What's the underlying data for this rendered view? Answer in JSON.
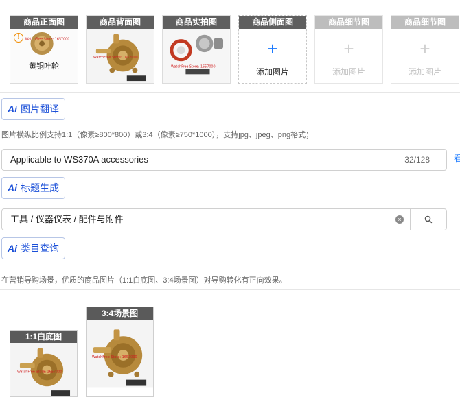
{
  "image_slots": [
    {
      "label": "商品正面图",
      "state": "filled",
      "caption": "黄铜叶轮",
      "warning_symbol": "!"
    },
    {
      "label": "商品背面图",
      "state": "filled",
      "caption": ""
    },
    {
      "label": "商品实拍图",
      "state": "filled",
      "caption": ""
    },
    {
      "label": "商品侧面图",
      "state": "empty",
      "add_symbol": "+",
      "add_text": "添加图片"
    },
    {
      "label": "商品细节图",
      "state": "disabled",
      "add_symbol": "+",
      "add_text": "添加图片"
    },
    {
      "label": "商品细节图",
      "state": "disabled",
      "add_symbol": "+",
      "add_text": "添加图片"
    }
  ],
  "ai_mark": "Ai",
  "image_translate": {
    "label": "图片翻译"
  },
  "image_hint": "图片横纵比例支持1:1（像素≥800*800）或3:4（像素≥750*1000），支持jpg、jpeg、png格式；",
  "title_input": {
    "value": "Applicable to WS370A accessories",
    "counter": "32/128"
  },
  "title_generate": {
    "label": "标题生成"
  },
  "category_input": {
    "value": "工具 / 仪器仪表 / 配件与附件",
    "clear_symbol": "×"
  },
  "category_query": {
    "label": "类目查询"
  },
  "guide_hint": "在营销导购场景，优质的商品图片（1:1白底图、3:4场景图）对导购转化有正向效果。",
  "guide_images": [
    {
      "label": "1:1白底图"
    },
    {
      "label": "3:4场景图"
    }
  ],
  "edge_text": "看",
  "colors": {
    "accent": "#1a4fd8",
    "plus_blue": "#1677ff",
    "label_bg": "#5f5f5f",
    "brass": "#c89b3c"
  }
}
